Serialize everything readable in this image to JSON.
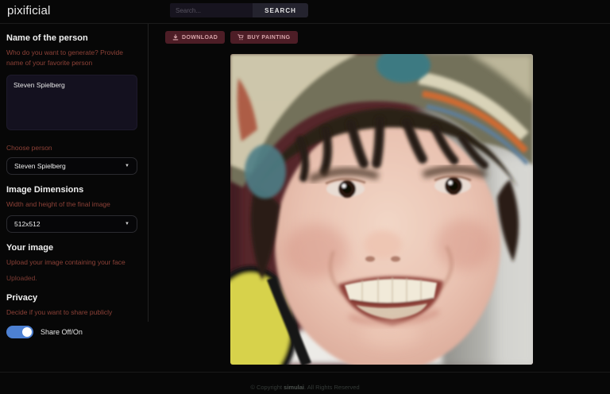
{
  "topbar": {
    "logo": "pixificial",
    "search_placeholder": "Search...",
    "search_button_label": "SEARCH"
  },
  "sidebar": {
    "name_section": {
      "title": "Name of the person",
      "description": "Who do you want to generate? Provide name of your favorite person",
      "name_value": "Steven Spielberg",
      "choose_label": "Choose person",
      "selected_person": "Steven Spielberg"
    },
    "dimensions_section": {
      "title": "Image Dimensions",
      "description": "Width and height of the final image",
      "selected_size": "512x512"
    },
    "image_section": {
      "title": "Your image",
      "description": "Upload your image containing your face",
      "status": "Uploaded."
    },
    "privacy_section": {
      "title": "Privacy",
      "description": "Decide if you want to share publicly",
      "toggle_label": "Share Off/On",
      "toggle_state": "on"
    }
  },
  "main": {
    "download_button_label": "DOWNLOAD",
    "buy_button_label": "BUY PAINTING",
    "photo_description": "Close-up of a smiling young boy with dark hair wearing an olive, teal and orange cap; maroon background at left, gray at right, yellow and black strap with white shirt at bottom left"
  },
  "footer": {
    "prefix": "© Copyright ",
    "brand": "simulai",
    "suffix": ". All Rights Reserved"
  },
  "colors": {
    "accent_text": "#8c4137",
    "action_button_bg": "#4d1d26",
    "action_button_text": "#d8a6ab",
    "toggle_on": "#4d80d2"
  }
}
